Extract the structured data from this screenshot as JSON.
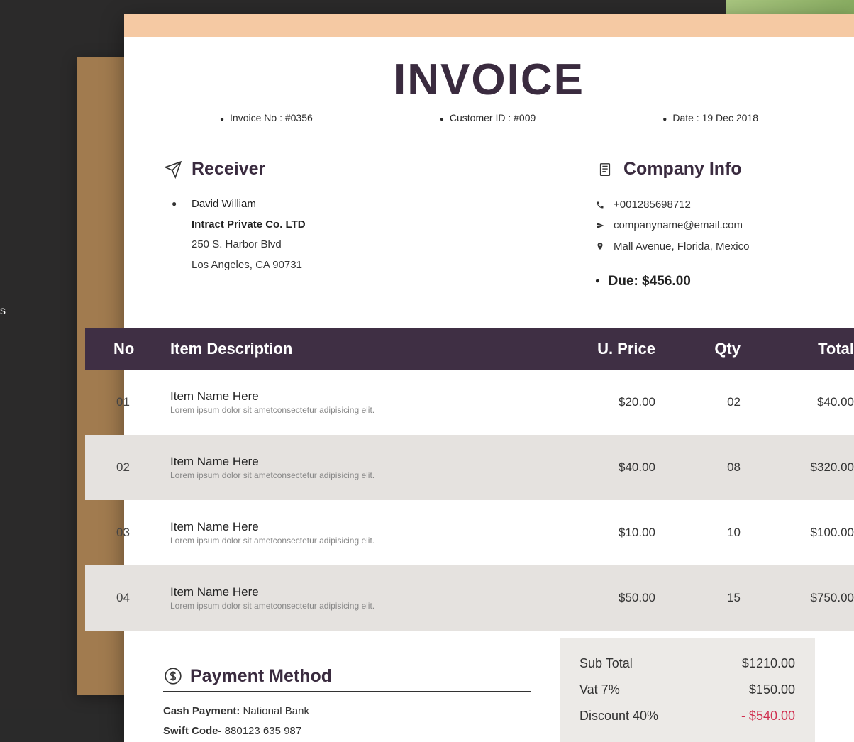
{
  "title": "INVOICE",
  "meta": {
    "invoice_no_label": "Invoice No : #0356",
    "customer_id_label": "Customer ID   : #009",
    "date_label": "Date  : 19 Dec 2018"
  },
  "receiver": {
    "heading": "Receiver",
    "name": "David William",
    "company": "Intract Private Co. LTD",
    "addr1": "250 S. Harbor Blvd",
    "addr2": "Los Angeles, CA 90731"
  },
  "company_info": {
    "heading": "Company Info",
    "phone": "+001285698712",
    "email": "companyname@email.com",
    "address": "Mall Avenue, Florida, Mexico",
    "due_label": "Due: $456.00"
  },
  "table": {
    "headers": {
      "no": "No",
      "desc": "Item Description",
      "price": "U. Price",
      "qty": "Qty",
      "total": "Total"
    },
    "rows": [
      {
        "no": "01",
        "name": "Item Name Here",
        "sub": "Lorem ipsum dolor sit ametconsectetur adipisicing elit.",
        "price": "$20.00",
        "qty": "02",
        "total": "$40.00"
      },
      {
        "no": "02",
        "name": "Item Name Here",
        "sub": "Lorem ipsum dolor sit ametconsectetur adipisicing elit.",
        "price": "$40.00",
        "qty": "08",
        "total": "$320.00"
      },
      {
        "no": "03",
        "name": "Item Name Here",
        "sub": "Lorem ipsum dolor sit ametconsectetur adipisicing elit.",
        "price": "$10.00",
        "qty": "10",
        "total": "$100.00"
      },
      {
        "no": "04",
        "name": "Item Name Here",
        "sub": "Lorem ipsum dolor sit ametconsectetur adipisicing elit.",
        "price": "$50.00",
        "qty": "15",
        "total": "$750.00"
      }
    ]
  },
  "payment": {
    "heading": "Payment Method",
    "cash_label": "Cash Payment:",
    "cash_value": "National Bank",
    "swift_label": "Swift Code-",
    "swift_value": "880123 635 987"
  },
  "totals": {
    "subtotal_label": "Sub Total",
    "subtotal_value": "$1210.00",
    "vat_label": "Vat 7%",
    "vat_value": "$150.00",
    "discount_label": "Discount 40%",
    "discount_value": "- $540.00"
  },
  "bg_tab": "s"
}
